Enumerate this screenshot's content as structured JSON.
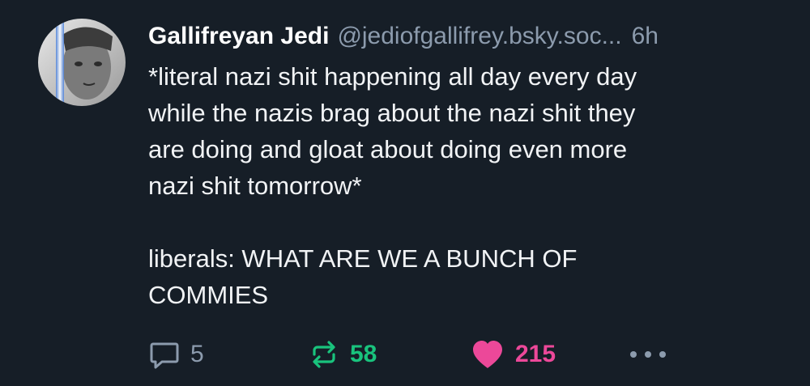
{
  "post": {
    "author": {
      "display_name": "Gallifreyan Jedi",
      "handle": "@jediofgallifrey.bsky.soc..."
    },
    "time_ago": "6h",
    "text": "*literal nazi shit happening all day every day\nwhile the nazis brag about the nazi shit they\nare doing and gloat about doing even more\nnazi shit tomorrow*\n\nliberals: WHAT ARE WE A BUNCH OF\nCOMMIES",
    "counts": {
      "replies": "5",
      "reposts": "58",
      "likes": "215"
    }
  },
  "icons": {
    "reply": "speech-bubble-icon",
    "repost": "repost-arrows-icon",
    "like": "heart-icon",
    "more": "ellipsis-icon"
  },
  "colors": {
    "background": "#161e27",
    "muted_text": "#8c9bad",
    "repost_active": "#19c37d",
    "like_active": "#ec4899"
  }
}
